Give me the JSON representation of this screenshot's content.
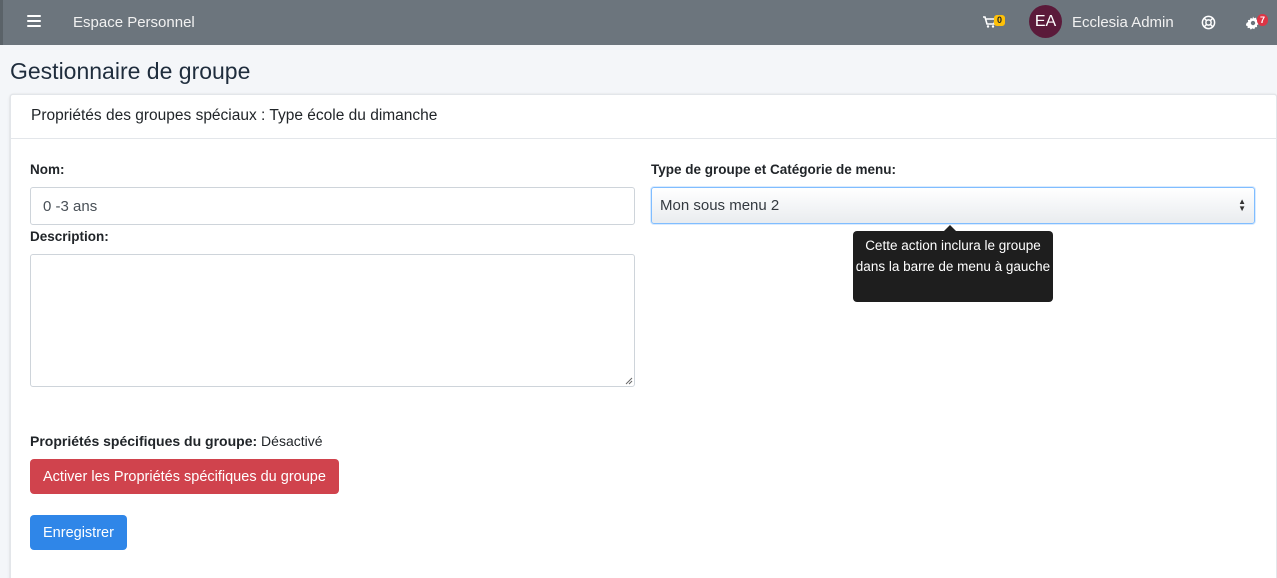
{
  "navbar": {
    "brand": "Espace Personnel",
    "cart_count": "0",
    "avatar_initials": "EA",
    "user_name": "Ecclesia Admin",
    "settings_count": "7"
  },
  "page": {
    "title": "Gestionnaire de groupe"
  },
  "card": {
    "header": "Propriétés des groupes spéciaux : Type école du dimanche"
  },
  "form": {
    "name_label": "Nom:",
    "name_value": "0 -3 ans",
    "description_label": "Description:",
    "description_value": "",
    "type_label": "Type de groupe et Catégorie de menu:",
    "type_selected": "Mon sous menu 2",
    "tooltip_text": "Cette action inclura le groupe dans la barre de menu à gauche",
    "props_label": "Propriétés spécifiques du groupe:",
    "props_status": "Désactivé",
    "activate_button": "Activer les Propriétés spécifiques du groupe",
    "save_button": "Enregistrer"
  },
  "icons": {
    "menu": "hamburger-icon",
    "cart": "cart-icon",
    "help": "lifebuoy-icon",
    "settings": "gear-icon"
  },
  "colors": {
    "navbar": "#6c757d",
    "avatar": "#5b1a3a",
    "danger": "#d0434d",
    "primary": "#2f86e8",
    "cart_badge": "#ffc107",
    "settings_badge": "#dc3545",
    "tooltip": "#1e1e1e"
  }
}
